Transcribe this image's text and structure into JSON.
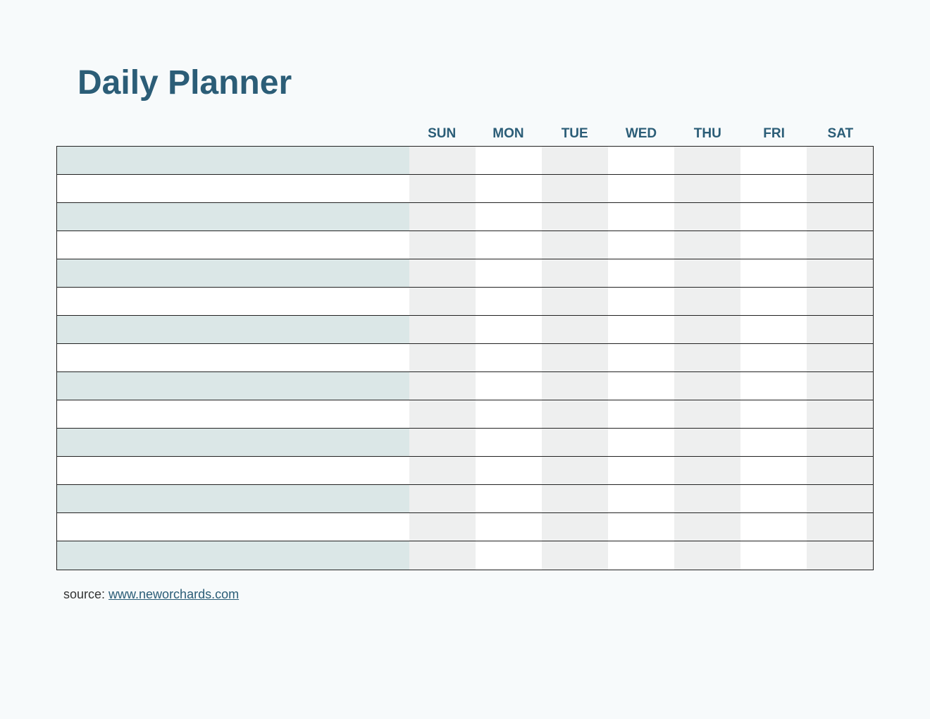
{
  "title": "Daily Planner",
  "days": [
    "SUN",
    "MON",
    "TUE",
    "WED",
    "THU",
    "FRI",
    "SAT"
  ],
  "row_count": 15,
  "source_label": "source: ",
  "source_link_text": "www.neworchards.com"
}
